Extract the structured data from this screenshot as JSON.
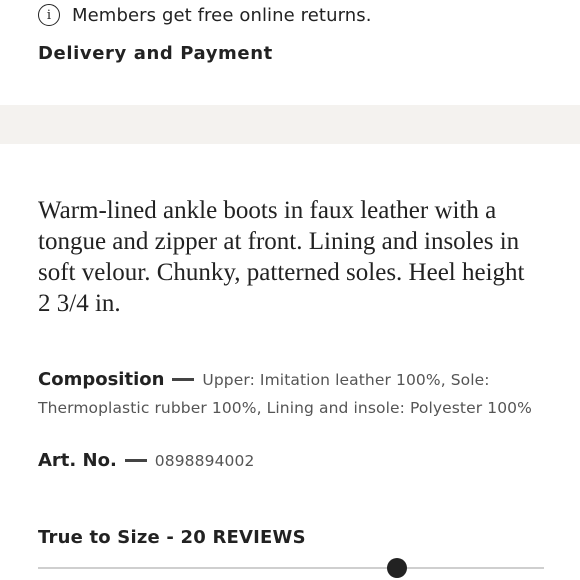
{
  "returns_notice": {
    "icon": "info-icon",
    "icon_glyph": "i",
    "text": "Members get free online returns."
  },
  "delivery": {
    "label": "Delivery and Payment"
  },
  "description": "Warm-lined ankle boots in faux leather with a tongue and zipper at front. Lining and insoles in soft velour. Chunky, patterned soles. Heel height 2 3/4 in.",
  "composition": {
    "label": "Composition",
    "value": "Upper: Imitation leather 100%,  Sole: Thermoplastic rubber 100%,  Lining and insole: Polyester 100%"
  },
  "article": {
    "label": "Art. No.",
    "value": "0898894002"
  },
  "fit": {
    "title": "True to Size - 20 REVIEWS",
    "position_fraction": 0.71
  },
  "colors": {
    "text": "#222222",
    "muted": "#555555",
    "band": "#f4f2ef",
    "track": "#cfcfcf"
  }
}
